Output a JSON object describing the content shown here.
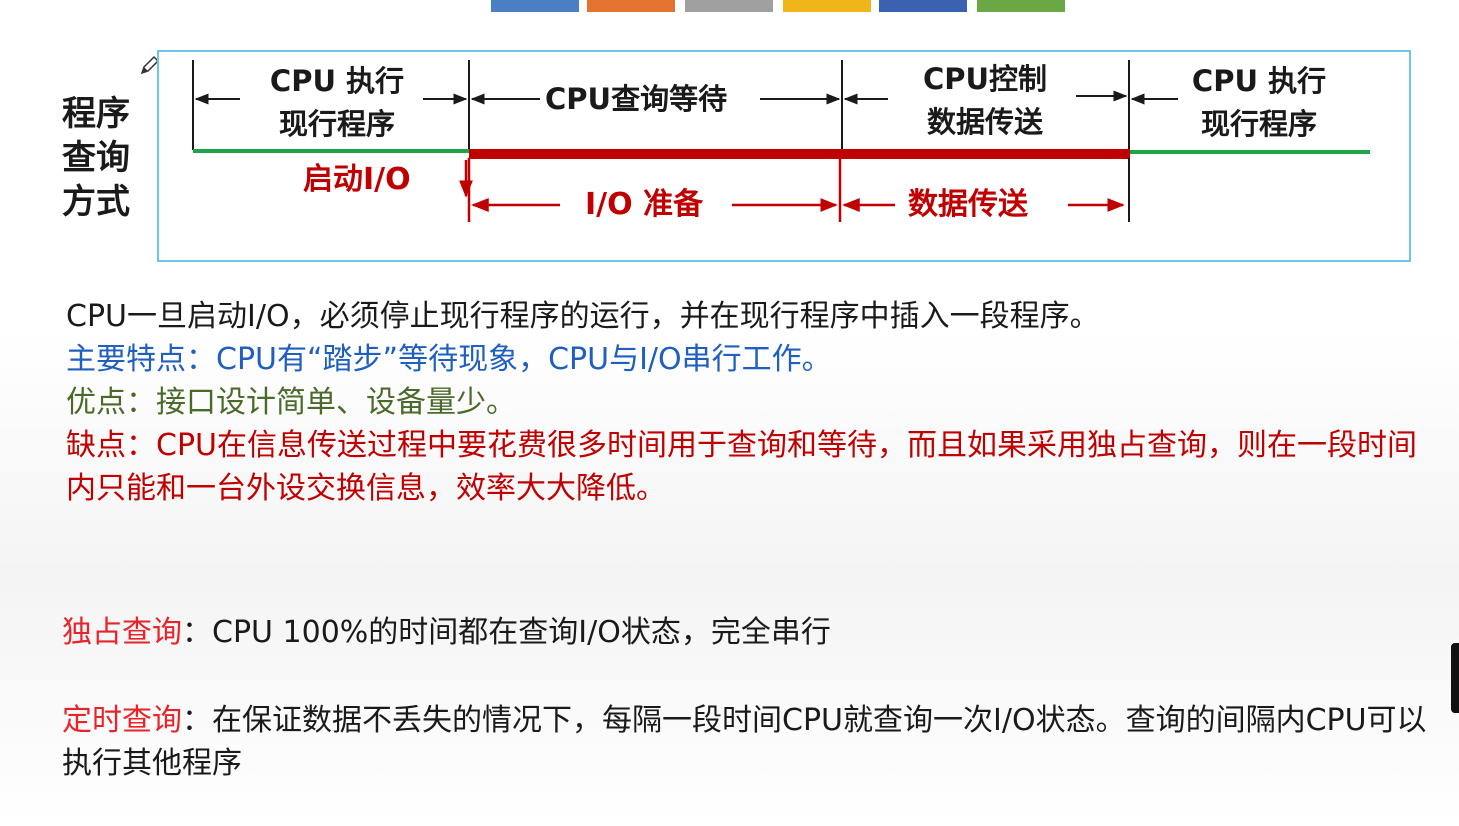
{
  "colors": {
    "top_bars": [
      "#4a7fc4",
      "#e2742f",
      "#a0a0a0",
      "#f1b51c",
      "#3a62b0",
      "#6aa845"
    ],
    "frame": "#6ec5ea",
    "green_line": "#1ea54a",
    "red_line": "#c00000",
    "blue_text": "#1f5fbf",
    "green_text": "#4a6a2a",
    "red_text": "#c00000",
    "bright_red_text": "#e8232a"
  },
  "diagram": {
    "side_label": "程序查询方式",
    "seg1": "CPU 执行现行程序",
    "seg2": "CPU查询等待",
    "seg3": "CPU控制数据传送",
    "seg4": "CPU 执行现行程序",
    "start_io": "启动I/O",
    "io_prepare": "I/O 准备",
    "data_transfer": "数据传送"
  },
  "text": {
    "line1": "CPU一旦启动I/O，必须停止现行程序的运行，并在现行程序中插入一段程序。",
    "feature_label": "主要特点：",
    "feature_body": "CPU有“踏步”等待现象，CPU与I/O串行工作。",
    "pros_label": "优点：",
    "pros_body": "接口设计简单、设备量少。",
    "cons_label": "缺点：",
    "cons_body": "CPU在信息传送过程中要花费很多时间用于查询和等待，而且如果采用独占查询，则在一段时间内只能和一台外设交换信息，效率大大降低。",
    "exclusive_label": "独占查询",
    "exclusive_sep": "：",
    "exclusive_body": "CPU 100%的时间都在查询I/O状态，完全串行",
    "timed_label": "定时查询",
    "timed_sep": "：",
    "timed_body": "在保证数据不丢失的情况下，每隔一段时间CPU就查询一次I/O状态。查询的间隔内CPU可以执行其他程序"
  }
}
